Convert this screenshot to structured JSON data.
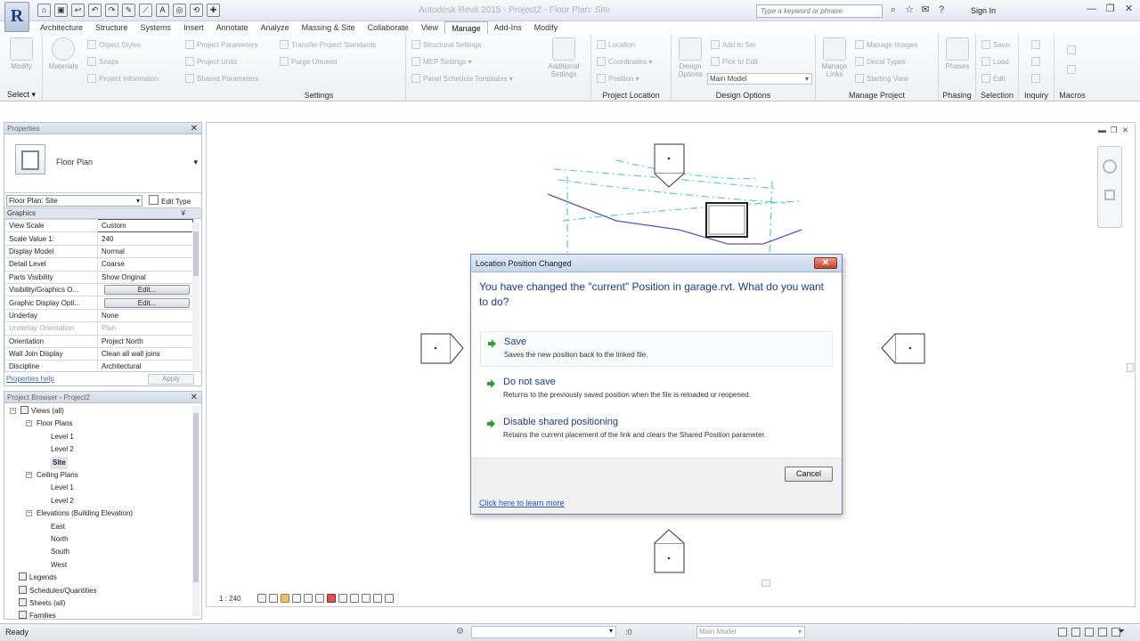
{
  "app": {
    "logo_letter": "R",
    "title": "Autodesk Revit 2015 - Project2 - Floor Plan: Site"
  },
  "quick_access": [
    "⌂",
    "▣",
    "↩",
    "↶",
    "↷",
    "✎",
    "⟋",
    "A",
    "◎",
    "⟲",
    "✚"
  ],
  "search": {
    "placeholder": "Type a keyword or phrase"
  },
  "title_icons": [
    "⌕",
    "☆",
    "✉",
    "?"
  ],
  "sign_in": "Sign In",
  "window_controls": [
    "—",
    "❐",
    "✕"
  ],
  "tabs": [
    "Architecture",
    "Structure",
    "Systems",
    "Insert",
    "Annotate",
    "Analyze",
    "Massing & Site",
    "Collaborate",
    "View",
    "Manage",
    "Add-Ins",
    "Modify"
  ],
  "active_tab": "Manage",
  "ribbon": {
    "select": {
      "modify": "Modify",
      "label": "Select ▾"
    },
    "settings": {
      "materials": "Materials",
      "items": [
        "Object Styles",
        "Snaps",
        "Project Information",
        "Project Parameters",
        "Project Units",
        "Shared Parameters",
        "Transfer Project Standards",
        "Purge Unused",
        "Structural Settings",
        "MEP Settings ▾",
        "Panel Schedule Templates ▾",
        "Additional Settings"
      ],
      "label": "Settings"
    },
    "project_location": {
      "items": [
        "Location",
        "Coordinates ▾",
        "Position ▾"
      ],
      "label": "Project Location"
    },
    "design_options": {
      "button": "Design Options",
      "items": [
        "Add to Set",
        "Pick to Edit"
      ],
      "select_value": "Main Model",
      "label": "Design Options"
    },
    "manage_project": {
      "button": "Manage Links",
      "items": [
        "Manage Images",
        "Decal Types",
        "Starting View"
      ],
      "label": "Manage Project"
    },
    "phasing": {
      "button": "Phases",
      "label": "Phasing"
    },
    "selection": {
      "items": [
        "Save",
        "Load",
        "Edit"
      ],
      "label": "Selection"
    },
    "inquiry": {
      "label": "Inquiry"
    },
    "macros": {
      "label": "Macros"
    }
  },
  "properties": {
    "header": "Properties",
    "type_name": "Floor Plan",
    "instance": "Floor Plan: Site",
    "edit_type": "Edit Type",
    "category": "Graphics",
    "rows": [
      {
        "name": "View Scale",
        "value": "Custom"
      },
      {
        "name": "Scale Value    1:",
        "value": "240"
      },
      {
        "name": "Display Model",
        "value": "Normal"
      },
      {
        "name": "Detail Level",
        "value": "Coarse"
      },
      {
        "name": "Parts Visibility",
        "value": "Show Original"
      },
      {
        "name": "Visibility/Graphics O...",
        "value": "Edit..."
      },
      {
        "name": "Graphic Display Opti...",
        "value": "Edit..."
      },
      {
        "name": "Underlay",
        "value": "None"
      },
      {
        "name": "Underlay Orientation",
        "value": "Plan"
      },
      {
        "name": "Orientation",
        "value": "Project North"
      },
      {
        "name": "Wall Join Display",
        "value": "Clean all wall joins"
      },
      {
        "name": "Discipline",
        "value": "Architectural"
      }
    ],
    "help": "Properties help",
    "apply": "Apply"
  },
  "browser": {
    "header": "Project Browser - Project2",
    "views": "Views (all)",
    "floor_plans": "Floor Plans",
    "floor_items": [
      "Level 1",
      "Level 2",
      "Site"
    ],
    "ceiling_plans": "Ceiling Plans",
    "ceiling_items": [
      "Level 1",
      "Level 2"
    ],
    "elevations": "Elevations (Building Elevation)",
    "elevation_items": [
      "East",
      "North",
      "South",
      "West"
    ],
    "others": [
      "Legends",
      "Schedules/Quantities",
      "Sheets (all)",
      "Families"
    ]
  },
  "viewbar": {
    "scale": "1 : 240"
  },
  "dialog": {
    "title": "Location Position Changed",
    "question": "You have changed the \"current\" Position in garage.rvt.  What do you want to do?",
    "options": [
      {
        "title": "Save",
        "desc": "Saves the new position back to the linked file."
      },
      {
        "title": "Do not save",
        "desc": "Returns to the previously saved position when the file is reloaded or reopened."
      },
      {
        "title": "Disable shared positioning",
        "desc": "Retains the current placement of the link and clears the Shared Position parameter."
      }
    ],
    "cancel": "Cancel",
    "link": "Click here to learn more"
  },
  "status": {
    "text": "Ready",
    "count": ":0",
    "model": "Main Model"
  },
  "colors": {
    "accent": "#1c3b8c",
    "site_lines": "#5ad1b4",
    "property_line": "#5a4fc7",
    "option_arrow": "#2e9e35"
  }
}
